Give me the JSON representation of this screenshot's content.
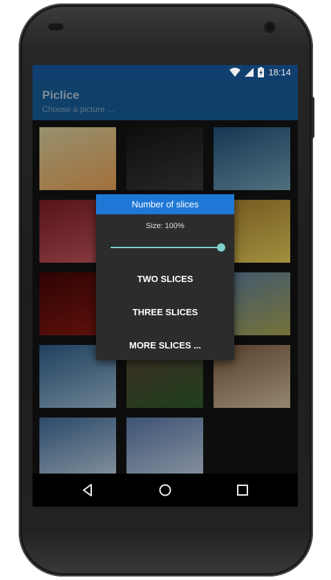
{
  "status_bar": {
    "time": "18:14",
    "icons": [
      "wifi-icon",
      "cell-signal-icon",
      "battery-charging-icon"
    ]
  },
  "app": {
    "title": "Piclice",
    "subtitle": "Choose a picture ..."
  },
  "grid": {
    "thumbnails": [
      {
        "name": "flowers-cream",
        "colors": [
          "#d8cf9f",
          "#e9a255"
        ]
      },
      {
        "name": "dark-orchid",
        "colors": [
          "#141414",
          "#3a3a3a"
        ]
      },
      {
        "name": "aquarium-fish",
        "colors": [
          "#1f4f78",
          "#74a1b5"
        ]
      },
      {
        "name": "red-leaves",
        "colors": [
          "#7b1d22",
          "#c85860"
        ]
      },
      {
        "name": "hidden-1",
        "colors": [
          "#222",
          "#333"
        ]
      },
      {
        "name": "yellow-lily",
        "colors": [
          "#a57d2e",
          "#e7cf5a"
        ]
      },
      {
        "name": "red-tree",
        "colors": [
          "#420605",
          "#8c1a12"
        ]
      },
      {
        "name": "hidden-2",
        "colors": [
          "#222",
          "#333"
        ]
      },
      {
        "name": "field-sky",
        "colors": [
          "#5d7fa2",
          "#a8a452"
        ]
      },
      {
        "name": "palm-fronds",
        "colors": [
          "#2e5d8a",
          "#9bbcd2"
        ]
      },
      {
        "name": "plant-seedling",
        "colors": [
          "#5a4234",
          "#2f5b2a"
        ]
      },
      {
        "name": "logs-wood",
        "colors": [
          "#7a5a3e",
          "#d8c2a0"
        ]
      },
      {
        "name": "palm-beach",
        "colors": [
          "#3f6b99",
          "#c0d3e3"
        ]
      },
      {
        "name": "palm-trees",
        "colors": [
          "#5777a7",
          "#c6d4e6"
        ]
      }
    ]
  },
  "dialog": {
    "title": "Number of slices",
    "size_label": "Size: 100%",
    "slider_value_fraction": 1.0,
    "buttons": [
      "TWO SLICES",
      "THREE SLICES",
      "MORE SLICES ..."
    ]
  },
  "nav_bar": {
    "icons": [
      "back-icon",
      "home-icon",
      "recents-icon"
    ]
  }
}
